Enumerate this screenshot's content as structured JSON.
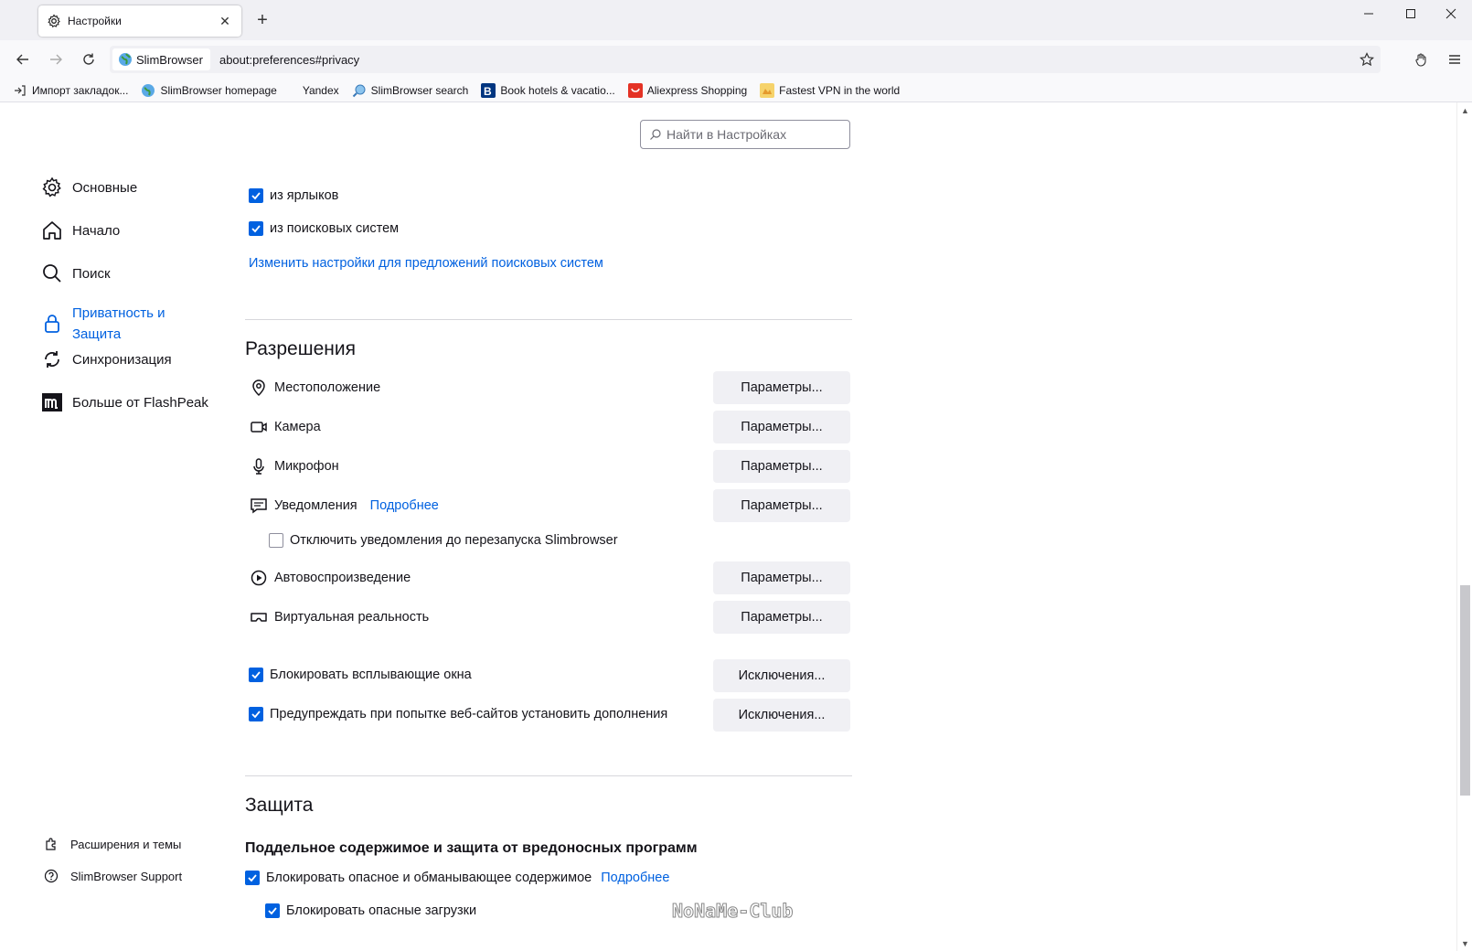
{
  "tab": {
    "title": "Настройки",
    "close": "✕",
    "new_tab": "+"
  },
  "window": {
    "minimize": "—",
    "maximize": "☐",
    "close": "✕"
  },
  "navbar": {
    "identity_label": "SlimBrowser",
    "url": "about:preferences#privacy"
  },
  "bookmarks": [
    {
      "label": "Импорт закладок...",
      "icon": "import-icon"
    },
    {
      "label": "SlimBrowser homepage",
      "icon": "globe-icon"
    },
    {
      "label": "Yandex",
      "icon": "none"
    },
    {
      "label": "SlimBrowser search",
      "icon": "search-globe-icon"
    },
    {
      "label": "Book hotels & vacatio...",
      "icon": "booking-icon"
    },
    {
      "label": "Aliexpress Shopping",
      "icon": "aliexpress-icon"
    },
    {
      "label": "Fastest VPN in the world",
      "icon": "vpn-icon"
    }
  ],
  "search": {
    "placeholder": "Найти в Настройках"
  },
  "sidebar": {
    "categories": [
      {
        "label": "Основные",
        "icon": "gear-icon"
      },
      {
        "label": "Начало",
        "icon": "home-icon"
      },
      {
        "label": "Поиск",
        "icon": "search-icon"
      },
      {
        "label": "Приватность и Защита",
        "icon": "lock-icon",
        "selected": true
      },
      {
        "label": "Синхронизация",
        "icon": "sync-icon"
      },
      {
        "label": "Больше от FlashPeak",
        "icon": "flashpeak-icon"
      }
    ],
    "footer": [
      {
        "label": "Расширения и темы",
        "icon": "puzzle-icon"
      },
      {
        "label": "SlimBrowser Support",
        "icon": "help-icon"
      }
    ]
  },
  "suggestions": {
    "from_shortcuts": "из ярлыков",
    "from_search": "из поисковых систем",
    "change_link": "Изменить настройки для предложений поисковых систем"
  },
  "permissions": {
    "heading": "Разрешения",
    "location": "Местоположение",
    "camera": "Камера",
    "microphone": "Микрофон",
    "notifications": "Уведомления",
    "notifications_link": "Подробнее",
    "pause_notifications": "Отключить уведомления до перезапуска Slimbrowser",
    "autoplay": "Автовоспроизведение",
    "vr": "Виртуальная реальность",
    "settings_button": "Параметры...",
    "block_popups": "Блокировать всплывающие окна",
    "warn_addons": "Предупреждать при попытке веб-сайтов установить дополнения",
    "exceptions_button": "Исключения..."
  },
  "security": {
    "heading": "Защита",
    "subheading": "Поддельное содержимое и защита от вредоносных программ",
    "block_dangerous": "Блокировать опасное и обманывающее содержимое",
    "block_dangerous_link": "Подробнее",
    "block_downloads": "Блокировать опасные загрузки"
  },
  "watermark": "NoNaMe-Club",
  "colors": {
    "accent": "#0061e0",
    "button_bg": "#f0f0f4",
    "divider": "#d7d7db"
  }
}
